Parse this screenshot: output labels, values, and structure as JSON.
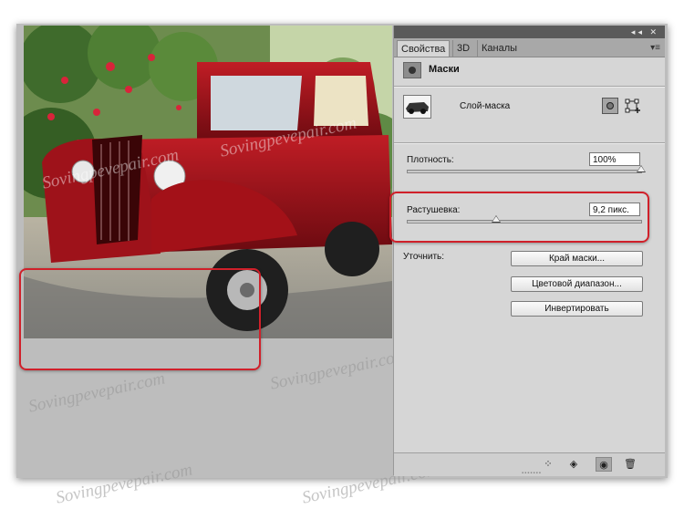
{
  "panel": {
    "tabs": [
      {
        "label": "Свойства",
        "active": true
      },
      {
        "label": "3D",
        "active": false
      },
      {
        "label": "Каналы",
        "active": false
      }
    ],
    "top_buttons": "◂◂ ✕",
    "menu_icon": "▾≡",
    "section_title": "Маски",
    "layer_label": "Слой-маска",
    "density": {
      "label": "Плотность:",
      "value": "100%",
      "percent": 100
    },
    "feather": {
      "label": "Растушевка:",
      "value": "9,2 пикс.",
      "slider_fraction": 0.38
    },
    "refine_label": "Уточнить:",
    "buttons": {
      "mask_edge": "Край маски...",
      "color_range": "Цветовой диапазон...",
      "invert": "Инвертировать"
    },
    "footer_icons": [
      "selection-dotted-icon",
      "apply-mask-icon",
      "eye-icon",
      "trash-icon"
    ]
  },
  "watermark": "Sovingpevepair.com",
  "colors": {
    "highlight": "#d0202a",
    "panel_bg": "#d6d6d6",
    "canvas_bg": "#bdbdbd"
  }
}
